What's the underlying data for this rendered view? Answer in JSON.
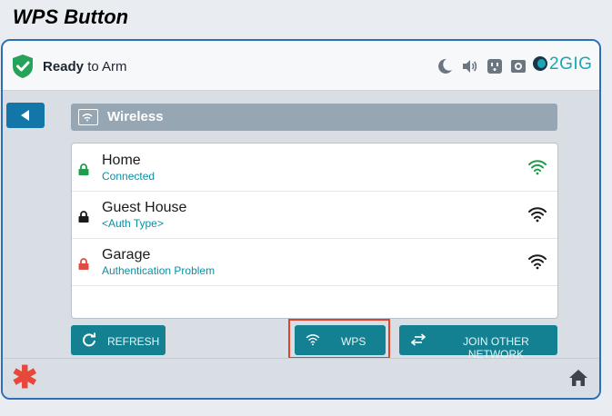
{
  "caption": "WPS Button",
  "status": {
    "bold": "Ready",
    "rest": " to Arm"
  },
  "brand": "2GIG",
  "header_icons": [
    "moon-icon",
    "speaker-icon",
    "outlet-icon",
    "camera-icon"
  ],
  "page_title": "Wireless",
  "networks": [
    {
      "name": "Home",
      "status": "Connected",
      "lock_color": "#1e9d4b",
      "wifi_color": "#1e9d4b"
    },
    {
      "name": "Guest House",
      "status": "<Auth Type>",
      "lock_color": "#1b1b1b",
      "wifi_color": "#1b1b1b"
    },
    {
      "name": "Garage",
      "status": "Authentication Problem",
      "lock_color": "#e24b42",
      "wifi_color": "#1b1b1b"
    }
  ],
  "buttons": {
    "refresh": "REFRESH",
    "wps": "WPS",
    "join": "JOIN OTHER NETWORK"
  },
  "colors": {
    "accent": "#138192",
    "highlight": "#e2442b",
    "panic": "#e8483a",
    "brand": "#1aa7b5"
  }
}
